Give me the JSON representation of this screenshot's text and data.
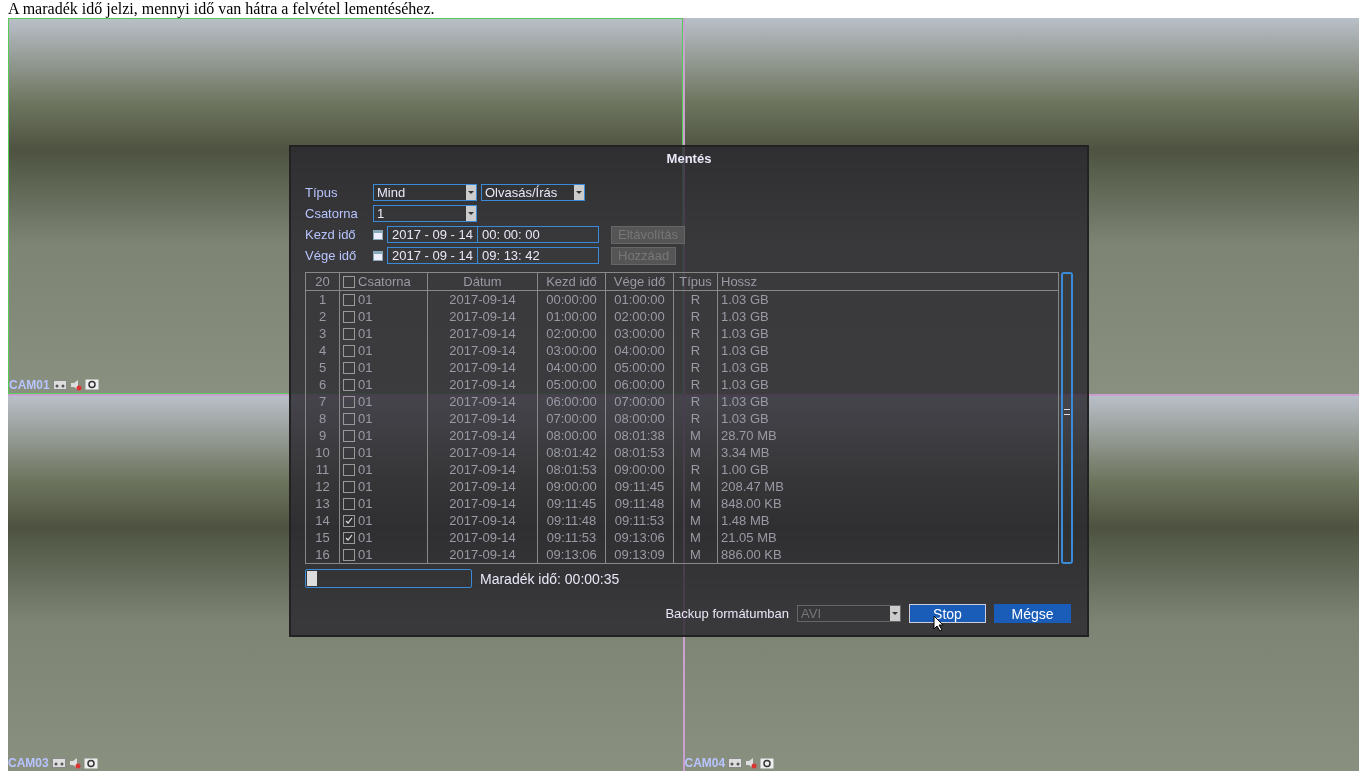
{
  "caption": "A maradék idő jelzi, mennyi idő van hátra a felvétel lementéséhez.",
  "cameras": [
    {
      "kind": "labeled",
      "label": "CAM01"
    },
    {
      "kind": "plain"
    },
    {
      "kind": "labeled",
      "label": "CAM03"
    },
    {
      "kind": "labeled",
      "label": "CAM04"
    }
  ],
  "dialog": {
    "title": "Mentés",
    "type_field": {
      "label": "Típus",
      "value": "Mind",
      "mode": "Olvasás/Írás"
    },
    "channel_field": {
      "label": "Csatorna",
      "value": "1"
    },
    "start": {
      "label": "Kezd idő",
      "date": "2017 - 09 - 14",
      "time": "00: 00: 00",
      "button": "Eltávolítás",
      "disabled": true
    },
    "end": {
      "label": "Vége idő",
      "date": "2017 - 09 - 14",
      "time": "09: 13: 42",
      "button": "Hozzáad",
      "disabled": true
    },
    "table": {
      "count": "20",
      "all_checked": false,
      "columns": [
        "Csatorna",
        "Dátum",
        "Kezd idő",
        "Vége idő",
        "Típus",
        "Hossz"
      ],
      "rows": [
        {
          "n": "1",
          "checked": false,
          "channel": "01",
          "date": "2017-09-14",
          "start": "00:00:00",
          "end": "01:00:00",
          "type": "R",
          "size": "1.03 GB"
        },
        {
          "n": "2",
          "checked": false,
          "channel": "01",
          "date": "2017-09-14",
          "start": "01:00:00",
          "end": "02:00:00",
          "type": "R",
          "size": "1.03 GB"
        },
        {
          "n": "3",
          "checked": false,
          "channel": "01",
          "date": "2017-09-14",
          "start": "02:00:00",
          "end": "03:00:00",
          "type": "R",
          "size": "1.03 GB"
        },
        {
          "n": "4",
          "checked": false,
          "channel": "01",
          "date": "2017-09-14",
          "start": "03:00:00",
          "end": "04:00:00",
          "type": "R",
          "size": "1.03 GB"
        },
        {
          "n": "5",
          "checked": false,
          "channel": "01",
          "date": "2017-09-14",
          "start": "04:00:00",
          "end": "05:00:00",
          "type": "R",
          "size": "1.03 GB"
        },
        {
          "n": "6",
          "checked": false,
          "channel": "01",
          "date": "2017-09-14",
          "start": "05:00:00",
          "end": "06:00:00",
          "type": "R",
          "size": "1.03 GB"
        },
        {
          "n": "7",
          "checked": false,
          "channel": "01",
          "date": "2017-09-14",
          "start": "06:00:00",
          "end": "07:00:00",
          "type": "R",
          "size": "1.03 GB"
        },
        {
          "n": "8",
          "checked": false,
          "channel": "01",
          "date": "2017-09-14",
          "start": "07:00:00",
          "end": "08:00:00",
          "type": "R",
          "size": "1.03 GB"
        },
        {
          "n": "9",
          "checked": false,
          "channel": "01",
          "date": "2017-09-14",
          "start": "08:00:00",
          "end": "08:01:38",
          "type": "M",
          "size": "28.70 MB"
        },
        {
          "n": "10",
          "checked": false,
          "channel": "01",
          "date": "2017-09-14",
          "start": "08:01:42",
          "end": "08:01:53",
          "type": "M",
          "size": "3.34 MB"
        },
        {
          "n": "11",
          "checked": false,
          "channel": "01",
          "date": "2017-09-14",
          "start": "08:01:53",
          "end": "09:00:00",
          "type": "R",
          "size": "1.00 GB"
        },
        {
          "n": "12",
          "checked": false,
          "channel": "01",
          "date": "2017-09-14",
          "start": "09:00:00",
          "end": "09:11:45",
          "type": "M",
          "size": "208.47 MB"
        },
        {
          "n": "13",
          "checked": false,
          "channel": "01",
          "date": "2017-09-14",
          "start": "09:11:45",
          "end": "09:11:48",
          "type": "M",
          "size": "848.00 KB"
        },
        {
          "n": "14",
          "checked": true,
          "channel": "01",
          "date": "2017-09-14",
          "start": "09:11:48",
          "end": "09:11:53",
          "type": "M",
          "size": "1.48 MB"
        },
        {
          "n": "15",
          "checked": true,
          "channel": "01",
          "date": "2017-09-14",
          "start": "09:11:53",
          "end": "09:13:06",
          "type": "M",
          "size": "21.05 MB"
        },
        {
          "n": "16",
          "checked": false,
          "channel": "01",
          "date": "2017-09-14",
          "start": "09:13:06",
          "end": "09:13:09",
          "type": "M",
          "size": "886.00 KB"
        }
      ]
    },
    "progress": {
      "level": 0.03,
      "label": "Maradék idő: 00:00:35"
    },
    "format": {
      "label": "Backup formátumban",
      "value": "AVI",
      "disabled": true
    },
    "buttons": [
      {
        "label": "Stop",
        "selected": true
      },
      {
        "label": "Mégse",
        "selected": false
      }
    ]
  }
}
